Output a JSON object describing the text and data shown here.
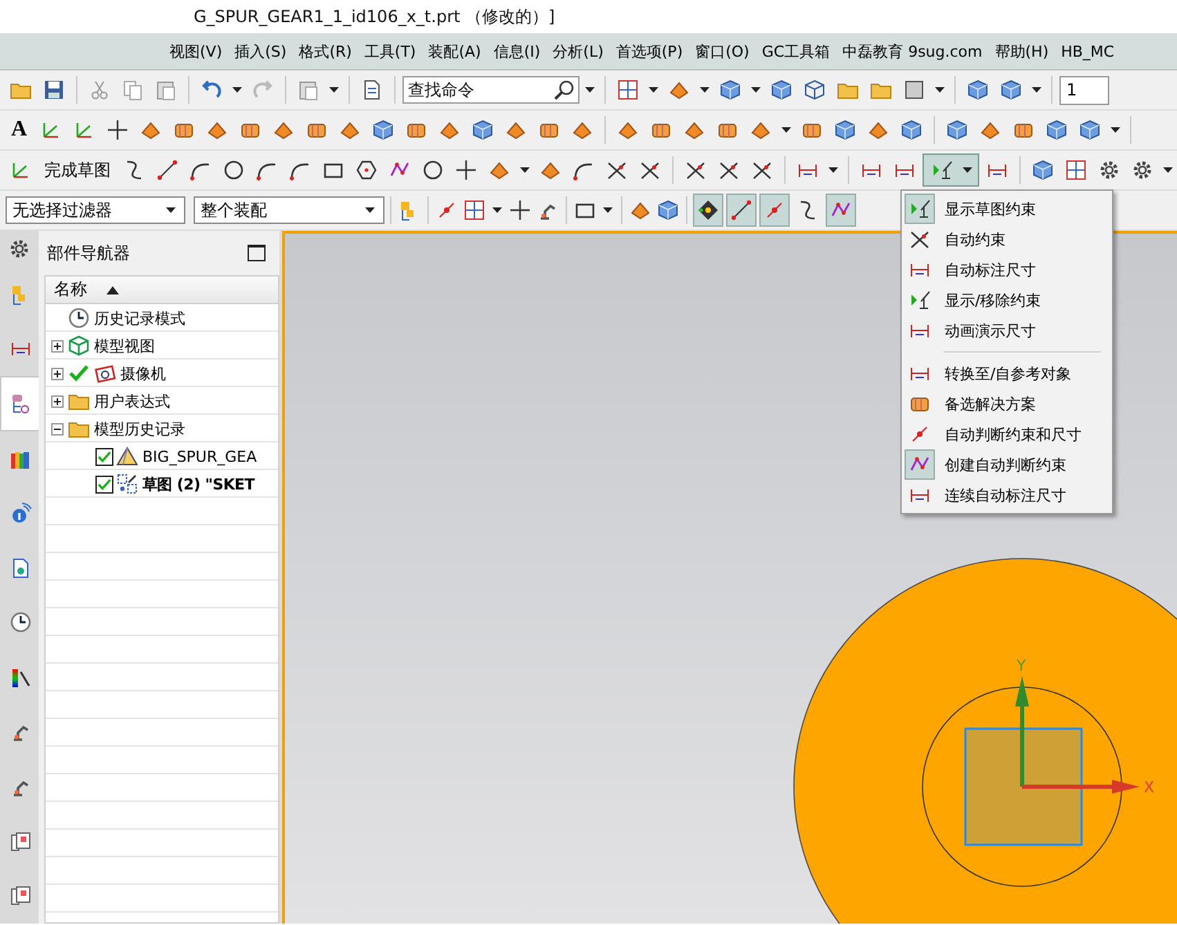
{
  "window": {
    "title": "G_SPUR_GEAR1_1_id106_x_t.prt （修改的）]"
  },
  "menu_bar": [
    "视图(V)",
    "插入(S)",
    "格式(R)",
    "工具(T)",
    "装配(A)",
    "信息(I)",
    "分析(L)",
    "首选项(P)",
    "窗口(O)",
    "GC工具箱",
    "中磊教育 9sug.com",
    "帮助(H)",
    "HB_MC"
  ],
  "standard_toolbar": {
    "search_placeholder": "查找命令",
    "layer_field": "1"
  },
  "feature_toolbar": {
    "text_glyph": "A"
  },
  "sketch_toolbar": {
    "finish_sketch": "完成草图",
    "constraint_dropdown_on": true
  },
  "selection_bar": {
    "filter": "无选择过滤器",
    "scope": "整个装配",
    "snap_buttons": [
      {
        "on": true
      },
      {
        "on": true
      },
      {
        "on": true
      },
      {
        "on": false
      },
      {
        "on": true
      }
    ]
  },
  "resource_bar": {
    "tabs": [
      {
        "selected": false
      },
      {
        "selected": false
      },
      {
        "selected": true
      },
      {
        "selected": false
      },
      {
        "selected": false
      },
      {
        "selected": false
      },
      {
        "selected": false
      },
      {
        "selected": false
      },
      {
        "selected": false
      },
      {
        "selected": false
      },
      {
        "selected": false
      },
      {
        "selected": false
      }
    ]
  },
  "part_navigator": {
    "title": "部件导航器",
    "column": "名称",
    "tree": [
      {
        "label": "历史记录模式",
        "kind": "clock"
      },
      {
        "label": "模型视图",
        "kind": "view",
        "expanded": false
      },
      {
        "label": "摄像机",
        "kind": "camera",
        "expanded": false,
        "checked": true
      },
      {
        "label": "用户表达式",
        "kind": "folder",
        "expanded": false
      },
      {
        "label": "模型历史记录",
        "kind": "folder",
        "expanded": true,
        "children": [
          {
            "label": "BIG_SPUR_GEA",
            "kind": "body",
            "checked": true,
            "active": false
          },
          {
            "label": "草图 (2) \"SKET",
            "kind": "sketch",
            "checked": true,
            "active": true
          }
        ]
      }
    ]
  },
  "constraint_menu": {
    "groups": [
      [
        {
          "label": "显示草图约束",
          "on": true
        },
        {
          "label": "自动约束",
          "on": false
        },
        {
          "label": "自动标注尺寸",
          "on": false
        },
        {
          "label": "显示/移除约束",
          "on": false
        },
        {
          "label": "动画演示尺寸",
          "on": false
        }
      ],
      [
        {
          "label": "转换至/自参考对象",
          "on": false
        },
        {
          "label": "备选解决方案",
          "on": false
        },
        {
          "label": "自动判断约束和尺寸",
          "on": false
        },
        {
          "label": "创建自动判断约束",
          "on": true
        },
        {
          "label": "连续自动标注尺寸",
          "on": false
        }
      ]
    ]
  },
  "graphics": {
    "x_axis_label": "X",
    "y_axis_label": "Y"
  }
}
